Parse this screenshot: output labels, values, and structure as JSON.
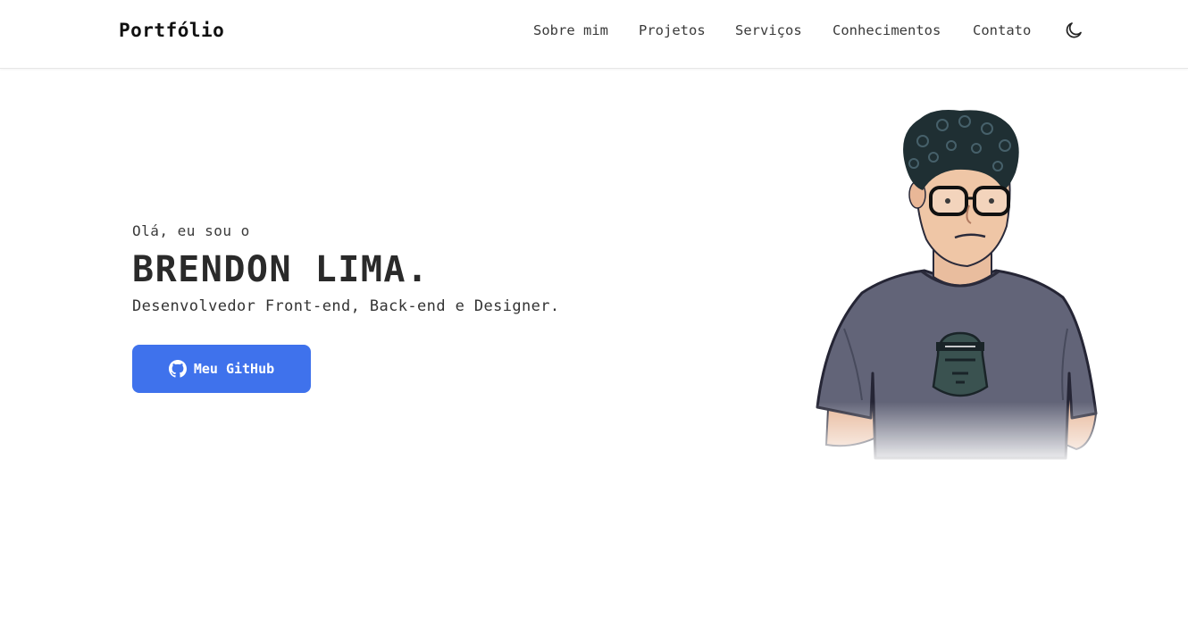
{
  "header": {
    "logo": "Portfólio",
    "nav": [
      {
        "label": "Sobre mim"
      },
      {
        "label": "Projetos"
      },
      {
        "label": "Serviços"
      },
      {
        "label": "Conhecimentos"
      },
      {
        "label": "Contato"
      }
    ],
    "theme_icon": "moon-icon"
  },
  "hero": {
    "greeting": "Olá, eu sou o",
    "name": "BRENDON LIMA.",
    "subtitle": "Desenvolvedor Front-end, Back-end e Designer.",
    "button_label": "Meu GitHub",
    "button_icon": "github-icon",
    "illustration": "avatar-illustration"
  },
  "colors": {
    "accent": "#3f72ec",
    "text": "#2b2b2b",
    "shirt": "#5f6173",
    "hair": "#1f2f33"
  }
}
